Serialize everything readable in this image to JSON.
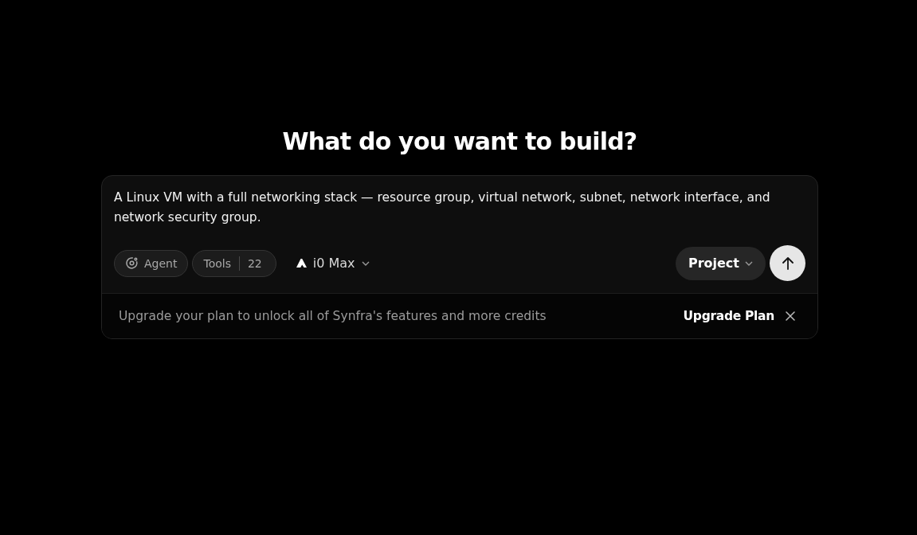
{
  "heading": "What do you want to build?",
  "prompt": {
    "value": "A Linux VM with a full networking stack — resource group, virtual network, subnet, network interface, and network security group."
  },
  "toolbar": {
    "mode": {
      "label": "Agent"
    },
    "tools": {
      "label": "Tools",
      "count": "22"
    },
    "model": {
      "label": "i0 Max"
    },
    "project": {
      "label": "Project"
    }
  },
  "upgrade_banner": {
    "message": "Upgrade your plan to unlock all of Synfra's features and more credits",
    "action": "Upgrade Plan"
  }
}
